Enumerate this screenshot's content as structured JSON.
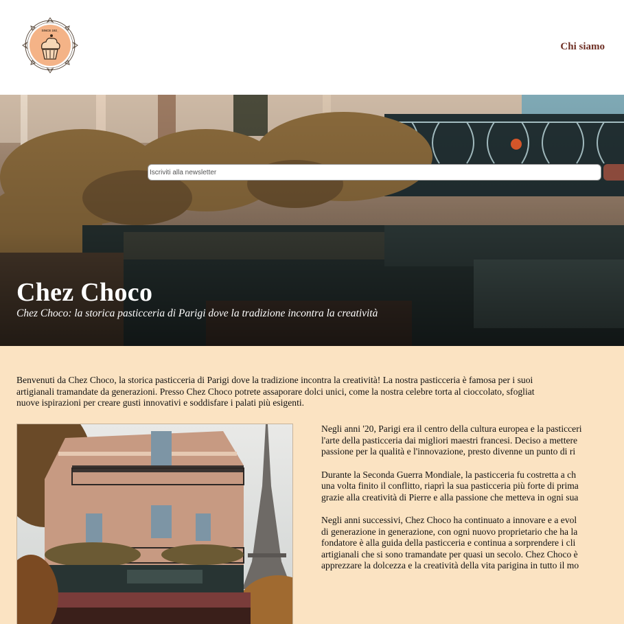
{
  "header": {
    "logo_alt": "SINCE 192_",
    "nav": {
      "about_label": "Chi siamo"
    }
  },
  "hero": {
    "newsletter_placeholder": "Iscriviti alla newsletter",
    "title": "Chez Choco",
    "subtitle": "Chez Choco: la storica pasticceria di Parigi dove la tradizione incontra la creatività"
  },
  "intro": {
    "lines": [
      "Benvenuti da Chez Choco, la storica pasticceria di Parigi dove la tradizione incontra la creatività! La nostra pasticceria è famosa per i suoi",
      "artigianali tramandate da generazioni. Presso Chez Choco potrete assaporare dolci unici, come la nostra celebre torta al cioccolato, sfogliat",
      "nuove ispirazioni per creare gusti innovativi e soddisfare i palati più esigenti."
    ]
  },
  "history": {
    "paragraphs": [
      [
        "Negli anni '20, Parigi era il centro della cultura europea e la pasticceri",
        "l'arte della pasticceria dai migliori maestri francesi. Deciso a mettere",
        "passione per la qualità e l'innovazione, presto divenne un punto di ri"
      ],
      [
        "Durante la Seconda Guerra Mondiale, la pasticceria fu costretta a ch",
        "una volta finito il conflitto, riaprì la sua pasticceria più forte di prima",
        "grazie alla creatività di Pierre e alla passione che metteva in ogni sua"
      ],
      [
        "Negli anni successivi, Chez Choco ha continuato a innovare e a evol",
        "di generazione in generazione, con ogni nuovo proprietario che ha la",
        "fondatore è alla guida della pasticceria e continua a sorprendere i cli",
        "artigianali che si sono tramandate per quasi un secolo. Chez Choco è",
        "apprezzare la dolcezza e la creatività della vita parigina in tutto il mo"
      ]
    ]
  },
  "colors": {
    "page_bg": "#fbe3c2",
    "brand": "#6e2f24",
    "button": "#8b4a3c"
  }
}
